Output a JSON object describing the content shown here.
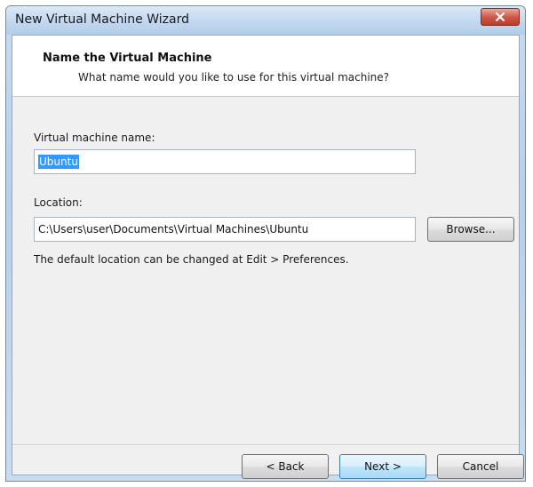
{
  "window": {
    "title": "New Virtual Machine Wizard"
  },
  "header": {
    "title": "Name the Virtual Machine",
    "subtitle": "What name would you like to use for this virtual machine?"
  },
  "form": {
    "name_label": "Virtual machine name:",
    "name_value": "Ubuntu",
    "location_label": "Location:",
    "location_value": "C:\\Users\\user\\Documents\\Virtual Machines\\Ubuntu",
    "browse_label": "Browse...",
    "hint": "The default location can be changed at Edit > Preferences."
  },
  "footer": {
    "back_label": "< Back",
    "next_label": "Next >",
    "cancel_label": "Cancel"
  },
  "icons": {
    "close": "close-icon"
  },
  "colors": {
    "selection": "#3399ff",
    "default_button_border": "#3c7fb1",
    "close_button": "#c8473a"
  }
}
